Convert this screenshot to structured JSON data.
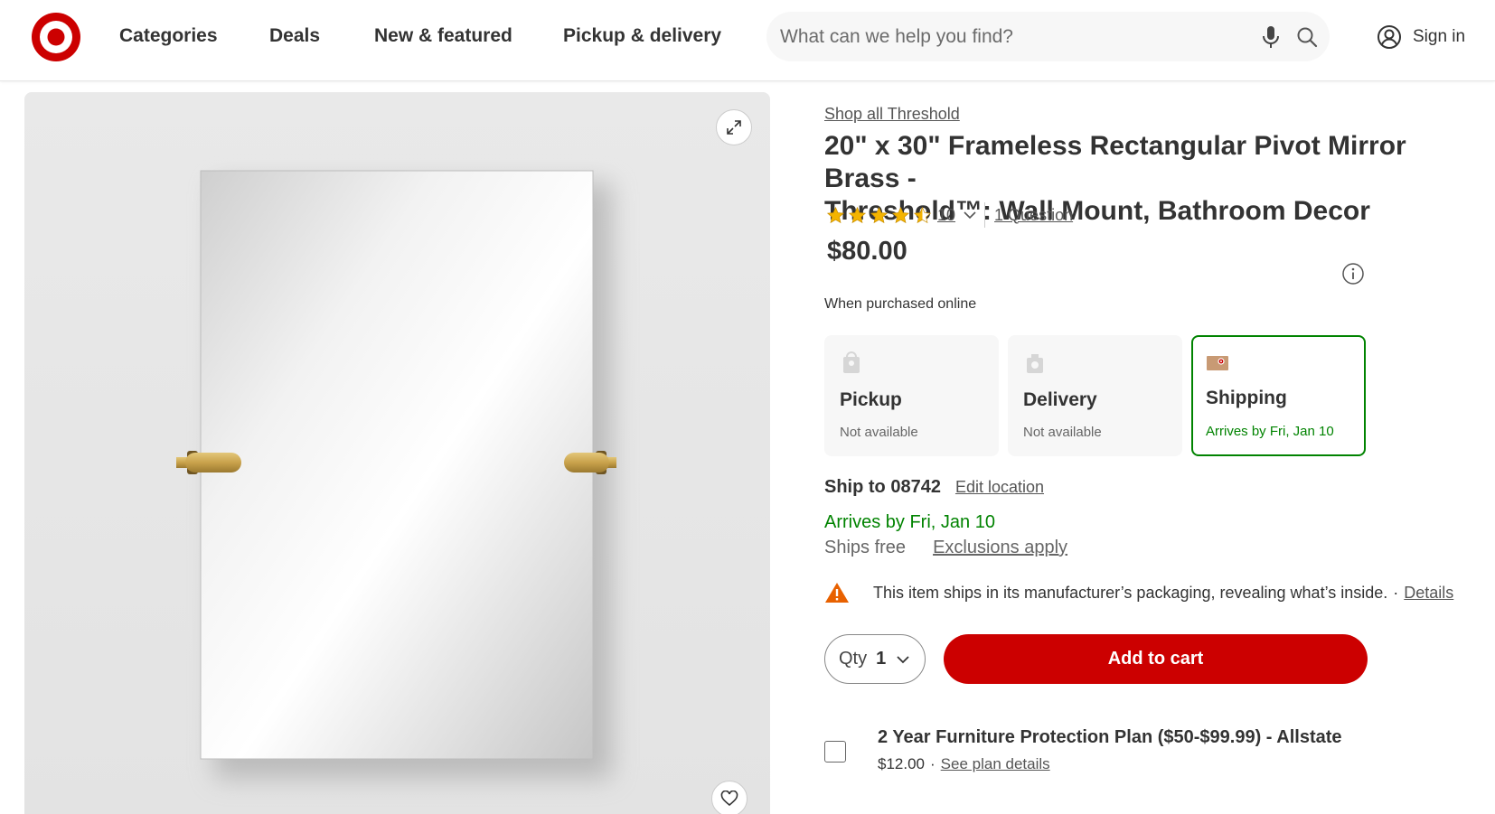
{
  "header": {
    "logo": "target-bullseye-logo",
    "nav": [
      "Categories",
      "Deals",
      "New & featured",
      "Pickup & delivery"
    ],
    "search_placeholder": "What can we help you find?",
    "sign_in": "Sign in"
  },
  "product": {
    "shop_link": "Shop all Threshold",
    "title_line1": "20\" x 30\" Frameless Rectangular Pivot Mirror Brass -",
    "title_line2": "Threshold™: Wall Mount, Bathroom Decor",
    "rating": 4.5,
    "rating_count": "10",
    "questions": "1 Question",
    "price": "$80.00",
    "purchased_note": "When purchased online"
  },
  "fulfillment": [
    {
      "title": "Pickup",
      "status": "Not available",
      "icon": "store-icon"
    },
    {
      "title": "Delivery",
      "status": "Not available",
      "icon": "delivery-icon"
    },
    {
      "title": "Shipping",
      "status": "Arrives by Fri, Jan 10",
      "icon": "shipping-box-icon"
    }
  ],
  "shipping": {
    "ship_to": "Ship to 08742",
    "edit_location": "Edit location",
    "arrives": "Arrives by Fri, Jan 10",
    "ships_free": "Ships free",
    "exclusions": "Exclusions apply"
  },
  "warning": {
    "text": "This item ships in its manufacturer’s packaging, revealing what’s inside.",
    "sep": "·",
    "details": "Details"
  },
  "cart": {
    "qty_label": "Qty",
    "qty_value": "1",
    "add_to_cart": "Add to cart"
  },
  "protection": {
    "title": "2 Year Furniture Protection Plan ($50-$99.99) - Allstate",
    "price": "$12.00",
    "sep": "·",
    "link": "See plan details"
  },
  "colors": {
    "brand_red": "#cc0000",
    "success_green": "#008300",
    "star_gold": "#f4b400",
    "warning_orange": "#e86100"
  }
}
